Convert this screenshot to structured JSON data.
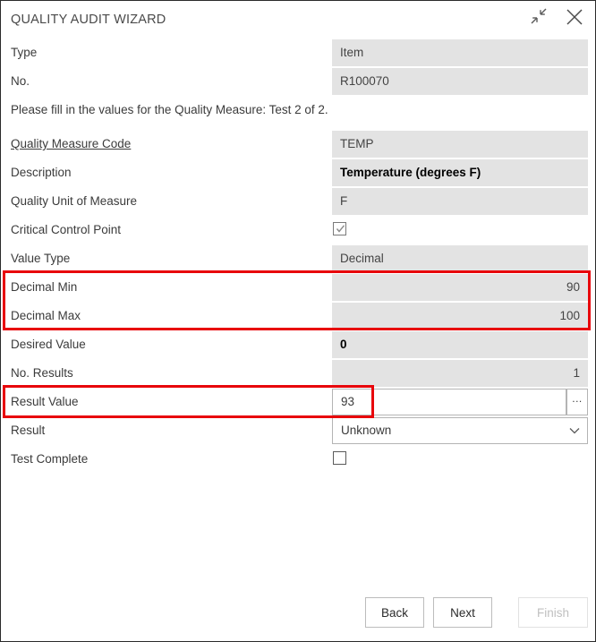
{
  "window": {
    "title": "QUALITY AUDIT WIZARD",
    "restore_icon": "shrink-diagonal-arrows-icon",
    "close_icon": "close-x-icon"
  },
  "colors": {
    "annotation_red": "#e8050b",
    "field_background": "#e3e3e3",
    "text": "#3b3b3b",
    "disabled_text": "#c0c0c0"
  },
  "instruction": "Please fill in the values for the Quality Measure: Test 2 of 2.",
  "fields": {
    "type": {
      "label": "Type",
      "value": "Item"
    },
    "no": {
      "label": "No.",
      "value": "R100070"
    },
    "quality_measure_code": {
      "label": "Quality Measure Code",
      "value": "TEMP"
    },
    "description": {
      "label": "Description",
      "value": "Temperature (degrees F)"
    },
    "quality_unit_of_measure": {
      "label": "Quality Unit of Measure",
      "value": "F"
    },
    "critical_control_point": {
      "label": "Critical Control Point",
      "checked": true
    },
    "value_type": {
      "label": "Value Type",
      "value": "Decimal"
    },
    "decimal_min": {
      "label": "Decimal Min",
      "value": "90"
    },
    "decimal_max": {
      "label": "Decimal Max",
      "value": "100"
    },
    "desired_value": {
      "label": "Desired Value",
      "value": "0"
    },
    "no_results": {
      "label": "No. Results",
      "value": "1"
    },
    "result_value": {
      "label": "Result Value",
      "value": "93",
      "assist_label": "..."
    },
    "result": {
      "label": "Result",
      "value": "Unknown",
      "options": [
        "Unknown"
      ]
    },
    "test_complete": {
      "label": "Test Complete",
      "checked": false
    }
  },
  "footer": {
    "back_label": "Back",
    "next_label": "Next",
    "finish_label": "Finish"
  }
}
